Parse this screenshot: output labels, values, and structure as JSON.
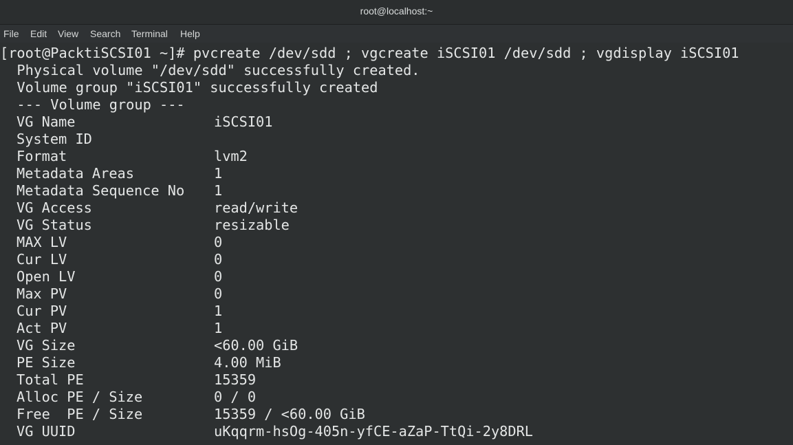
{
  "window": {
    "title": "root@localhost:~"
  },
  "menubar": {
    "items": [
      "File",
      "Edit",
      "View",
      "Search",
      "Terminal",
      "Help"
    ]
  },
  "terminal": {
    "command_line": "[root@PacktiSCSI01 ~]# pvcreate /dev/sdd ; vgcreate iSCSI01 /dev/sdd ; vgdisplay iSCSI01",
    "messages": [
      "  Physical volume \"/dev/sdd\" successfully created.",
      "  Volume group \"iSCSI01\" successfully created",
      "  --- Volume group ---"
    ],
    "fields": [
      {
        "label": "VG Name",
        "value": "iSCSI01"
      },
      {
        "label": "System ID",
        "value": ""
      },
      {
        "label": "Format",
        "value": "lvm2"
      },
      {
        "label": "Metadata Areas",
        "value": "1"
      },
      {
        "label": "Metadata Sequence No",
        "value": "1"
      },
      {
        "label": "VG Access",
        "value": "read/write"
      },
      {
        "label": "VG Status",
        "value": "resizable"
      },
      {
        "label": "MAX LV",
        "value": "0"
      },
      {
        "label": "Cur LV",
        "value": "0"
      },
      {
        "label": "Open LV",
        "value": "0"
      },
      {
        "label": "Max PV",
        "value": "0"
      },
      {
        "label": "Cur PV",
        "value": "1"
      },
      {
        "label": "Act PV",
        "value": "1"
      },
      {
        "label": "VG Size",
        "value": "<60.00 GiB"
      },
      {
        "label": "PE Size",
        "value": "4.00 MiB"
      },
      {
        "label": "Total PE",
        "value": "15359"
      },
      {
        "label": "Alloc PE / Size",
        "value": "0 / 0"
      },
      {
        "label": "Free  PE / Size",
        "value": "15359 / <60.00 GiB"
      },
      {
        "label": "VG UUID",
        "value": "uKqqrm-hsOg-405n-yfCE-aZaP-TtQi-2y8DRL"
      }
    ]
  }
}
